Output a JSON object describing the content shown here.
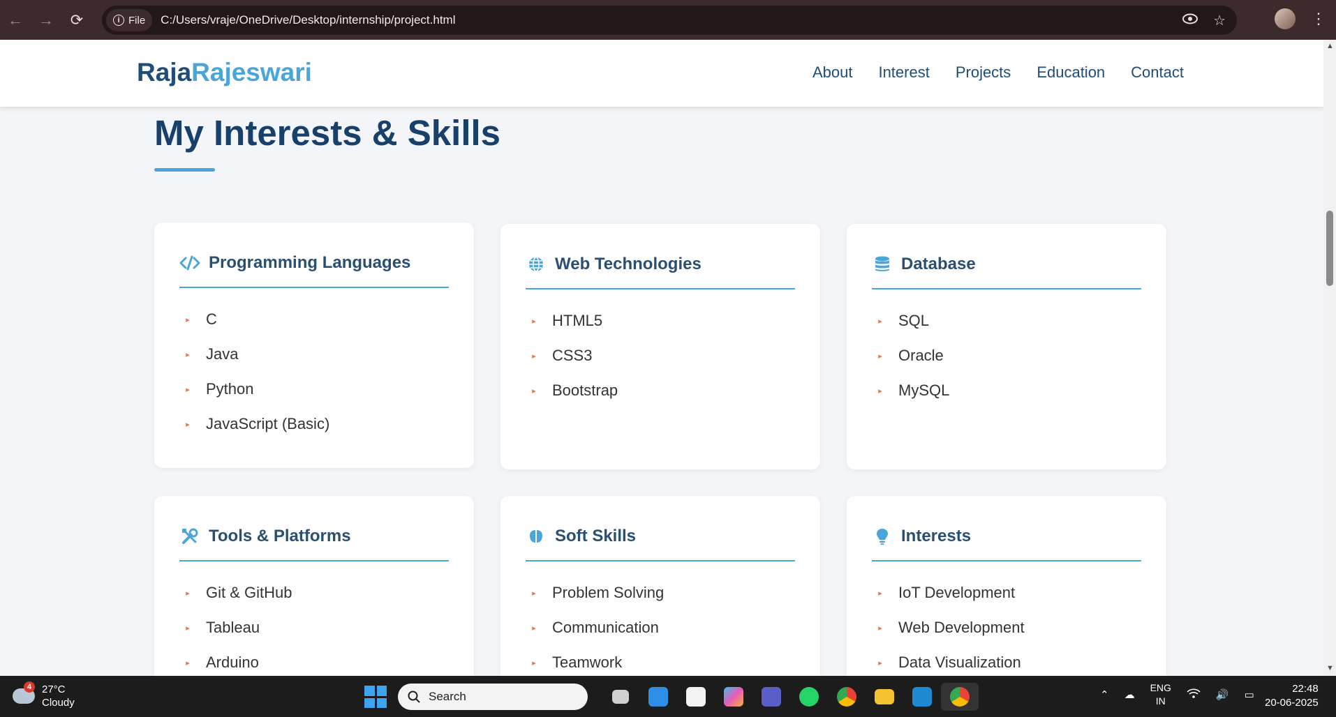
{
  "browser": {
    "chip_label": "File",
    "url": "C:/Users/vraje/OneDrive/Desktop/internship/project.html"
  },
  "site": {
    "logo_first": "Raja",
    "logo_second": "Rajeswari",
    "nav": [
      "About",
      "Interest",
      "Projects",
      "Education",
      "Contact"
    ]
  },
  "section": {
    "title": "My Interests & Skills"
  },
  "cards": [
    {
      "title": "Programming Languages",
      "icon": "code-icon",
      "items": [
        "C",
        "Java",
        "Python",
        "JavaScript (Basic)"
      ]
    },
    {
      "title": "Web Technologies",
      "icon": "globe-icon",
      "items": [
        "HTML5",
        "CSS3",
        "Bootstrap"
      ]
    },
    {
      "title": "Database",
      "icon": "database-icon",
      "items": [
        "SQL",
        "Oracle",
        "MySQL"
      ]
    },
    {
      "title": "Tools & Platforms",
      "icon": "tools-icon",
      "items": [
        "Git & GitHub",
        "Tableau",
        "Arduino"
      ]
    },
    {
      "title": "Soft Skills",
      "icon": "brain-icon",
      "items": [
        "Problem Solving",
        "Communication",
        "Teamwork"
      ]
    },
    {
      "title": "Interests",
      "icon": "lightbulb-icon",
      "items": [
        "IoT Development",
        "Web Development",
        "Data Visualization"
      ]
    }
  ],
  "colors": {
    "primary": "#1f4d78",
    "accent": "#4aa6d8",
    "bullet": "#e8734a",
    "background": "#f3f5f9"
  },
  "taskbar": {
    "weather_badge": "4",
    "temperature": "27°C",
    "condition": "Cloudy",
    "search_label": "Search",
    "lang_line1": "ENG",
    "lang_line2": "IN",
    "time": "22:48",
    "date": "20-06-2025"
  }
}
